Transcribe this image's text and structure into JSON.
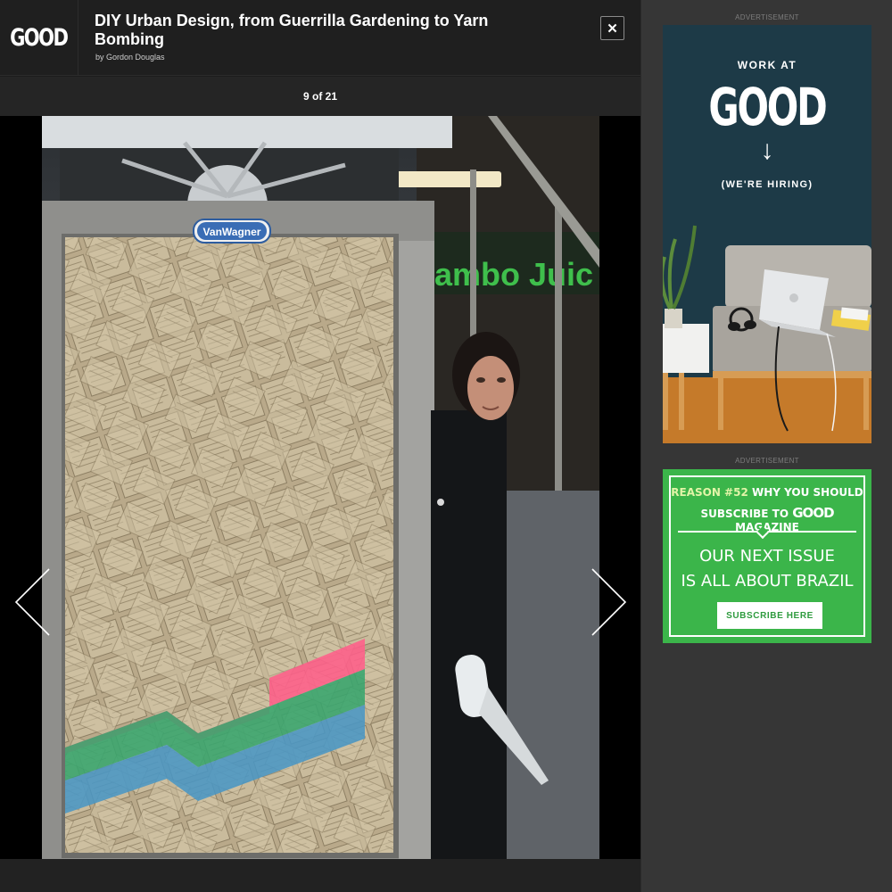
{
  "brand": {
    "logo_text": "GOOD"
  },
  "article": {
    "title": "DIY Urban Design, from Guerrilla Gardening to Yarn Bombing",
    "byline": "by Gordon Douglas"
  },
  "gallery": {
    "counter": "9 of 21",
    "close_label": "✕",
    "photo_sign_text": "VanWagner",
    "photo_storefront_text": "ambo Juic"
  },
  "sidebar": {
    "ad1": {
      "label": "ADVERTISEMENT",
      "line1": "WORK AT",
      "logo": "GOOD",
      "arrow": "↓",
      "line2": "(WE'RE HIRING)"
    },
    "ad2": {
      "label": "ADVERTISEMENT",
      "l1_a": "REASON #52",
      "l1_b": " WHY YOU SHOULD",
      "l2_a": "SUBSCRIBE TO ",
      "l2_logo": "GOOD",
      "l2_b": " MAGAZINE",
      "big1": "OUR NEXT ISSUE",
      "big2": "IS ALL ABOUT BRAZIL",
      "cta": "SUBSCRIBE HERE"
    }
  },
  "icons": {
    "prev": "chevron-left-icon",
    "next": "chevron-right-icon",
    "close": "close-icon"
  },
  "colors": {
    "ad_green": "#3bb54a",
    "ad_navy": "#1d3a47",
    "background": "#333333"
  }
}
